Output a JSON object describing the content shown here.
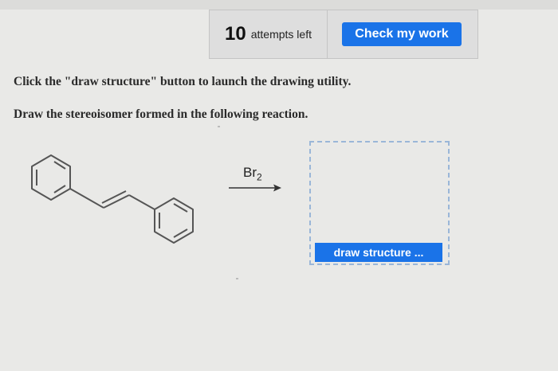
{
  "attempts": {
    "count": "10",
    "label": "attempts left"
  },
  "check_button_label": "Check my work",
  "instructions": {
    "line1": "Click the \"draw structure\" button to launch the drawing utility.",
    "line2": "Draw the stereoisomer formed in the following reaction."
  },
  "reaction": {
    "reagent": "Br",
    "reagent_subscript": "2"
  },
  "draw_button_label": "draw structure ...",
  "colors": {
    "accent": "#1a73e8",
    "dashed_border": "#9ab6d8"
  }
}
